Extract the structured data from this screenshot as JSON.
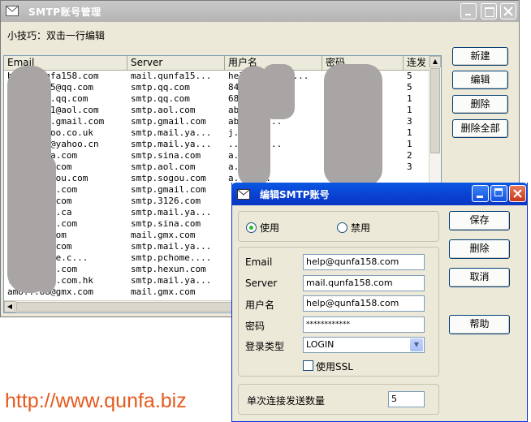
{
  "main_window": {
    "title": "SMTP账号管理",
    "tip": "小技巧：双击一行编辑",
    "columns": [
      "Email",
      "Server",
      "用户名",
      "密码",
      "连发"
    ],
    "rows": [
      {
        "email": "h...@qunfa158.com",
        "server": "mail.qunfa15...",
        "user": "help@qunfa15...",
        "count": "5"
      },
      {
        "email": "8...7...5@qq.com",
        "server": "smtp.qq.com",
        "user": "846...",
        "count": "5"
      },
      {
        "email": "6...30...qq.com",
        "server": "smtp.qq.com",
        "user": "686...0",
        "count": "1"
      },
      {
        "email": "a...e...1@aol.com",
        "server": "smtp.aol.com",
        "user": "ab...",
        "count": "1"
      },
      {
        "email": "a...80...gmail.com",
        "server": "smtp.gmail.com",
        "user": "ab...80...",
        "count": "3"
      },
      {
        "email": "j...@yahoo.co.uk",
        "server": "smtp.mail.ya...",
        "user": "j...",
        "count": "1"
      },
      {
        "email": "t...3ree@yahoo.cn",
        "server": "smtp.mail.ya...",
        "user": "...3ree...",
        "count": "1"
      },
      {
        "email": "a...@sina.com",
        "server": "smtp.sina.com",
        "user": "a...",
        "count": "2"
      },
      {
        "email": "ab...aol.com",
        "server": "smtp.aol.com",
        "user": "a...",
        "count": "3"
      },
      {
        "email": "ab...@sogou.com",
        "server": "smtp.sogou.com",
        "user": "a...8...",
        "count": ""
      },
      {
        "email": "a...gmail.com",
        "server": "smtp.gmail.com",
        "user": "",
        "count": ""
      },
      {
        "email": "a...3126.com",
        "server": "smtp.3126.com",
        "user": "",
        "count": ""
      },
      {
        "email": "a...yahoo.ca",
        "server": "smtp.mail.ya...",
        "user": "",
        "count": ""
      },
      {
        "email": "j...@sina.com",
        "server": "smtp.sina.com",
        "user": "",
        "count": ""
      },
      {
        "email": "j...gmx.com",
        "server": "mail.gmx.com",
        "user": "",
        "count": ""
      },
      {
        "email": "a...mimo.com",
        "server": "smtp.mail.ya...",
        "user": "",
        "count": ""
      },
      {
        "email": "...@pchome.c...",
        "server": "smtp.pchome....",
        "user": "",
        "count": ""
      },
      {
        "email": "...@hexun.com",
        "server": "smtp.hexun.com",
        "user": "",
        "count": ""
      },
      {
        "email": "...@yahoo.com.hk",
        "server": "smtp.mail.ya...",
        "user": "",
        "count": ""
      },
      {
        "email": "amo...88@gmx.com",
        "server": "mail.gmx.com",
        "user": "",
        "count": ""
      }
    ],
    "buttons": {
      "new": "新建",
      "edit": "编辑",
      "delete": "删除",
      "delete_all": "删除全部"
    }
  },
  "dialog": {
    "title": "编辑SMTP账号",
    "radio_enable": "使用",
    "radio_disable": "禁用",
    "email_label": "Email",
    "email_value": "help@qunfa158.com",
    "server_label": "Server",
    "server_value": "mail.qunfa158.com",
    "user_label": "用户名",
    "user_value": "help@qunfa158.com",
    "password_label": "密码",
    "password_value": "************",
    "login_type_label": "登录类型",
    "login_type_value": "LOGIN",
    "ssl_label": "使用SSL",
    "per_conn_label": "单次连接发送数量",
    "per_conn_value": "5",
    "buttons": {
      "save": "保存",
      "delete": "删除",
      "cancel": "取消",
      "help": "帮助"
    }
  },
  "watermark": "http://www.qunfa.biz"
}
